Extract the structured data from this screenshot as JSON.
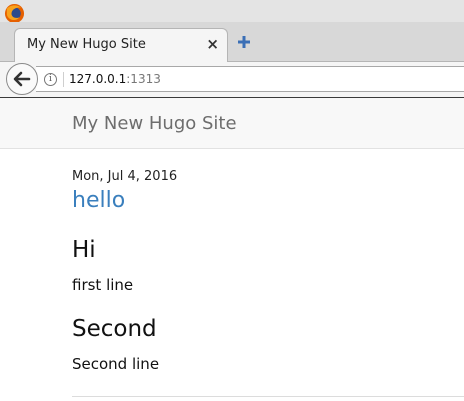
{
  "browser": {
    "logo_icon": "firefox-icon",
    "tab": {
      "title": "My New Hugo Site",
      "close_icon": "close-icon"
    },
    "new_tab_icon": "plus-icon",
    "back_icon": "arrow-left-icon",
    "info_icon": "info-icon",
    "url": {
      "host": "127.0.0.1",
      "port": ":1313"
    }
  },
  "site": {
    "title": "My New Hugo Site"
  },
  "post": {
    "date": "Mon, Jul 4, 2016",
    "title": "hello",
    "sections": [
      {
        "heading": "Hi",
        "text": "first line"
      },
      {
        "heading": "Second",
        "text": "Second line"
      }
    ]
  },
  "colors": {
    "link": "#3a7fbd",
    "header_bg": "#f8f8f8",
    "site_title": "#6d6d6d"
  }
}
